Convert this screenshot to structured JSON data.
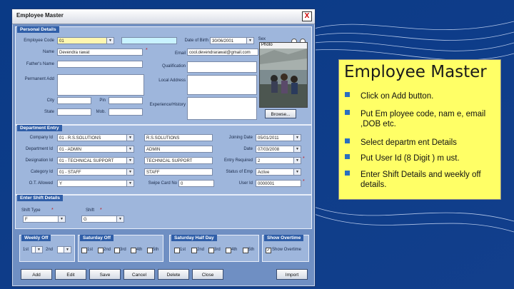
{
  "window": {
    "title": "Employee Master",
    "close_glyph": "X"
  },
  "personal": {
    "group_title": "Personal Details",
    "employee_code_label": "Employee Code",
    "employee_code_value": "01",
    "name_label": "Name",
    "name_value": "Devendra rawat",
    "fathers_name_label": "Father's Name",
    "permanent_add_label": "Permanent Add",
    "city_label": "City",
    "pin_label": "Pin",
    "state_label": "State",
    "mob_label": "Mob.",
    "dob_label": "Date of Birth",
    "dob_value": "30/06/2001",
    "sex_label": "Sex",
    "email_label": "Email",
    "email_value": "cool.devendrarawat@gmail.com",
    "qualification_label": "Qualification",
    "local_address_label": "Local Address",
    "experience_label": "Experience/History",
    "photo_label": "Photo",
    "browse_label": "Browse..."
  },
  "department": {
    "group_title": "Department Entry",
    "company_id_label": "Company Id",
    "company_id_value": "01 - R.S.SOLUTIONS",
    "company_name_value": "R.S.SOLUTIONS",
    "department_id_label": "Department Id",
    "department_id_value": "01 - ADMIN",
    "department_name_value": "ADMIN",
    "designation_id_label": "Designation Id",
    "designation_id_value": "01 - TECHNICAL SUPPORT",
    "designation_name_value": "TECHNICAL SUPPORT",
    "category_id_label": "Category Id",
    "category_id_value": "01 - STAFF",
    "category_name_value": "STAFF",
    "ot_allowed_label": "O.T. Allowed",
    "ot_allowed_value": "Y",
    "swipe_card_label": "Swipe Card No",
    "swipe_card_value": "0",
    "joining_date_label": "Joining Date",
    "joining_date_value": "05/01/2011",
    "date_label": "Date",
    "date_value": "07/03/2008",
    "entry_required_label": "Entry Required",
    "entry_required_value": "2",
    "status_label": "Status of Emp",
    "status_value": "Active",
    "user_id_label": "User Id",
    "user_id_value": "0000001"
  },
  "shift": {
    "group_title": "Enter Shift Details",
    "shift_type_label": "Shift Type",
    "shift_type_value": "F",
    "shift_label": "Shift",
    "shift_value": "G"
  },
  "weekly_off": {
    "title": "Weekly Off",
    "first_label": "1st",
    "second_label": "2nd"
  },
  "saturday_off": {
    "title": "Saturday Off",
    "options": [
      "1st",
      "2nd",
      "3rd",
      "4th",
      "5th"
    ]
  },
  "saturday_half": {
    "title": "Saturday Half Day",
    "options": [
      "1st",
      "2nd",
      "3rd",
      "4th",
      "5th"
    ]
  },
  "show_overtime": {
    "title": "Show Overtime",
    "checkbox_label": "Show Overtime"
  },
  "buttons": {
    "add": "Add",
    "edit": "Edit",
    "save": "Save",
    "cancel": "Cancel",
    "delete": "Delete",
    "close": "Close",
    "import": "Import"
  },
  "slide": {
    "title": "Employee Master",
    "bullets": [
      "Click on Add button.",
      "Put Em ployee code, nam e, email ,DOB etc.",
      "Select departm ent Details",
      "Put User Id (8 Digit ) m ust.",
      "Enter Shift Details and weekly off details."
    ]
  },
  "colors": {
    "background": "#0c3e8a",
    "panel": "#ffff66",
    "window": "#6f8fc3",
    "group": "#9eb6dc"
  }
}
